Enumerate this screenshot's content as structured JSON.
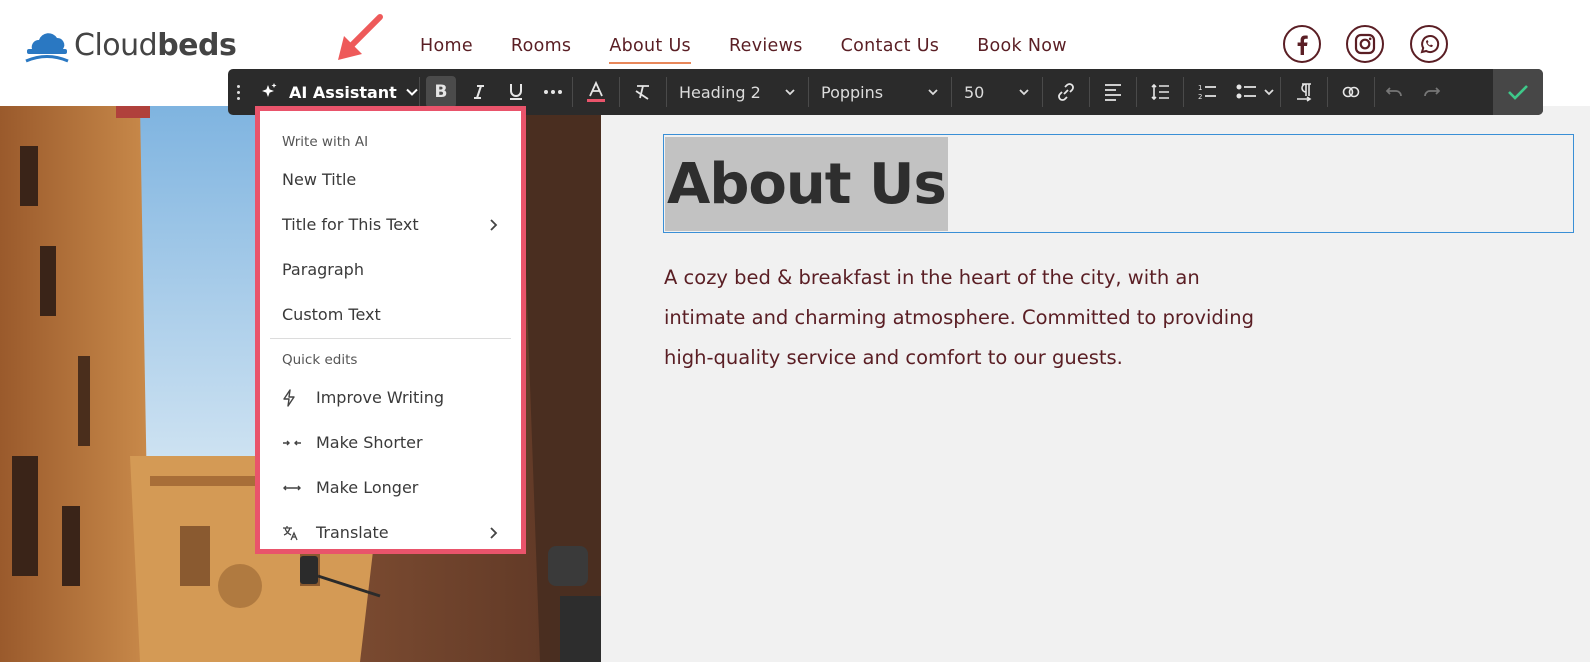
{
  "brand": {
    "name_light": "Cloud",
    "name_bold": "beds",
    "color": "#2a78c2"
  },
  "nav": {
    "items": [
      {
        "label": "Home",
        "active": false
      },
      {
        "label": "Rooms",
        "active": false
      },
      {
        "label": "About Us",
        "active": true
      },
      {
        "label": "Reviews",
        "active": false
      },
      {
        "label": "Contact Us",
        "active": false
      },
      {
        "label": "Book Now",
        "active": false
      }
    ]
  },
  "social": [
    "facebook-icon",
    "instagram-icon",
    "whatsapp-icon"
  ],
  "toolbar": {
    "ai_label": "AI Assistant",
    "bold": "B",
    "style": "Heading 2",
    "font": "Poppins",
    "size": "50"
  },
  "ai_menu": {
    "section1": "Write with AI",
    "items1": [
      {
        "label": "New Title",
        "submenu": false
      },
      {
        "label": "Title for This Text",
        "submenu": true
      },
      {
        "label": "Paragraph",
        "submenu": false
      },
      {
        "label": "Custom Text",
        "submenu": false
      }
    ],
    "section2": "Quick edits",
    "items2": [
      {
        "label": "Improve Writing",
        "icon": "lightning-icon"
      },
      {
        "label": "Make Shorter",
        "icon": "arrows-in-icon"
      },
      {
        "label": "Make Longer",
        "icon": "arrows-out-icon"
      },
      {
        "label": "Translate",
        "icon": "translate-icon",
        "submenu": true
      }
    ]
  },
  "content": {
    "heading": "About Us",
    "paragraph_lines": [
      "A cozy bed & breakfast in the heart of the city, with an",
      "intimate and charming atmosphere. Committed to providing",
      "high-quality service and comfort to our guests."
    ]
  },
  "colors": {
    "accent": "#5a1e24",
    "highlight_border": "#e9546b",
    "confirm": "#3ec98a",
    "selection_outline": "#3a8fd6"
  }
}
